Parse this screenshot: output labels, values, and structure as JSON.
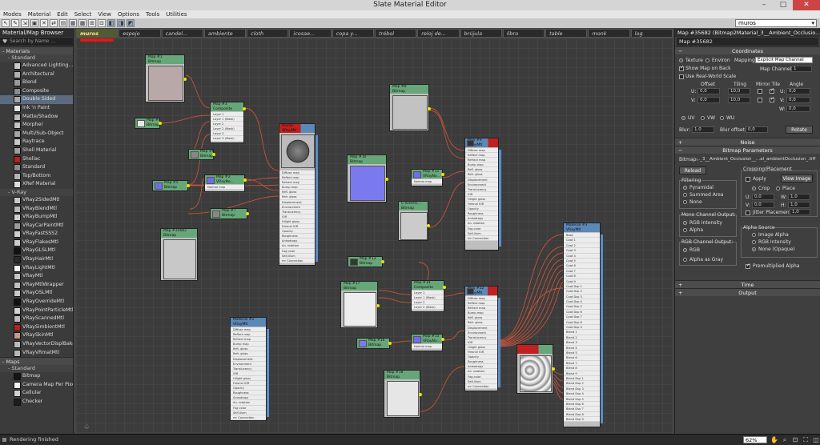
{
  "app": {
    "title": "Slate Material Editor",
    "window_controls": [
      "–",
      "□",
      "✕"
    ],
    "menu": [
      "Modes",
      "Material",
      "Edit",
      "Select",
      "View",
      "Options",
      "Tools",
      "Utilities"
    ],
    "material_dropdown": "muros",
    "status": "Rendering finished",
    "zoom": "62%"
  },
  "browser": {
    "title": "Material/Map Browser",
    "search_placeholder": "Search by Name ...",
    "materials_label": "- Materials",
    "standard_label": "- Standard",
    "standard_items": [
      "Advanced Lighting...",
      "Architectural",
      "Blend",
      "Composite",
      "Double Sided",
      "Ink 'n Paint",
      "Matte/Shadow",
      "Morpher",
      "Multi/Sub-Object",
      "Raytrace",
      "Shell Material",
      "Shellac",
      "Standard",
      "Top/Bottom",
      "XRef Material"
    ],
    "standard_swatches": [
      "#c9c9c9",
      "#b0b0b0",
      "#9a9a9a",
      "#8c8c8c",
      "#a8a8a8",
      "#e5e5e5",
      "#bcbcbc",
      "#c4c4c4",
      "#a5a5a5",
      "#c8c8c8",
      "#9e9e9e",
      "#b52222",
      "#8a8a8a",
      "#b4b4b4",
      "#dddddd"
    ],
    "vray_label": "- V-Ray",
    "vray_items": [
      "VRay2SidedMtl",
      "VRayBlendMtl",
      "VRayBumpMtl",
      "VRayCarPaintMtl",
      "VRayFastSSS2",
      "VRayFlakesMtl",
      "VRayGLSLMtl",
      "VRayHairMtl",
      "VRayLightMtl",
      "VRayMtl",
      "VRayMtlWrapper",
      "VRayOSLMtl",
      "VRayOverrideMtl",
      "VRayPointParticleMtl",
      "VRayScannedMtl",
      "VRaySimbiontMtl",
      "VRaySkinMtl",
      "VRayVectorDisplBake",
      "VRayVRmatMtl"
    ],
    "vray_swatches": [
      "#c9c9c9",
      "#b8b8b8",
      "#cfcfcf",
      "#9a9a9a",
      "#d0d0d0",
      "#cccccc",
      "#111111",
      "#2a2a2a",
      "#f5f5f5",
      "#c6c6c6",
      "#c0c0c0",
      "#c8c8c8",
      "#111111",
      "#d5d5d5",
      "#bdbdbd",
      "#b52222",
      "#c59a8a",
      "#bababa",
      "#b8b8b8"
    ],
    "maps_label": "- Maps",
    "maps_standard_label": "- Standard",
    "maps_items": [
      "Bitmap",
      "Camera Map Per Pixel",
      "Cellular",
      "Checker"
    ],
    "maps_swatches": [
      "#151515",
      "#f4f4f4",
      "#cfcfcf",
      "#1d1d1d"
    ]
  },
  "view_tabs": [
    "muros",
    "espejo",
    "candel...",
    "ambiente",
    "cloth",
    "icosae...",
    "copa y...",
    "trébol",
    "reloj de...",
    "brújula",
    "libro",
    "table",
    "monk",
    "log"
  ],
  "nodes": {
    "map1": "Map #1\nBitmap",
    "map2": "Map #2\nVRayNo...",
    "map3": "Map #3\nComposite",
    "map4": "Map #4\nBitmap",
    "map5": "Map #5\nBitmap",
    "map6": "Map #6\nBitmap",
    "map7": "Map #7\nBitmap",
    "map8": "Map #8\nBitmap",
    "map9": "Map #9\nVRayMtl",
    "map10": "Map #10\nBitmap",
    "map11": "Map #11\nVRayNo...",
    "map12": "Map #12\nVRayMtl",
    "map13": "Map #13\nBitmap",
    "map14": "Map #14\nComposite",
    "map15": "Map #15\nVRayNo...",
    "map16": "Map #16\nBitmap",
    "map17": "Map #17\nBitmap",
    "map18": "Map #18\nBitmap",
    "map35682": "Map #35682\nBitmap",
    "muros": "muros\nVRayMtl",
    "mat2": "Material #2\nVRayMtl",
    "multimat": "Material #3\nVRayMtl",
    "ambocc": "C:\\Users\\...\nBitmap"
  },
  "slots": {
    "composite": [
      "Layer 1",
      "Layer 1 (Mask)",
      "Layer 2",
      "Layer 2 (Mask)",
      "Layer 3",
      "Layer 3 (Mask)"
    ],
    "composite_short": [
      "Layer 1",
      "Layer 1 (Mask)",
      "Layer 2",
      "Layer 2 (Mask)"
    ],
    "vraynormal": [
      "Normal map"
    ],
    "vraymtl": [
      "Diffuse map",
      "Reflect map",
      "Refract map",
      "Bump map",
      "Refl. gloss",
      "Refr. gloss",
      "Displacement",
      "Environment",
      "Translucency",
      "IOR",
      "Hilight gloss",
      "Fresnel IOR",
      "Opacity",
      "Roughness",
      "Anisotropy",
      "An. rotation",
      "Fog color",
      "Self-illum",
      "mr Connection"
    ],
    "multimat": [
      "Base",
      "Coat 1",
      "Coat 2",
      "Coat 3",
      "Coat 4",
      "Coat 5",
      "Coat 6",
      "Coat 7",
      "Coat 8",
      "Coat 9",
      "Coat Dsp 1",
      "Coat Dsp 2",
      "Coat Dsp 3",
      "Coat Dsp 4",
      "Coat Dsp 5",
      "Coat Dsp 6",
      "Coat Dsp 7",
      "Coat Dsp 8",
      "Coat Dsp 9",
      "Blend 1",
      "Blend 2",
      "Blend 3",
      "Blend 4",
      "Blend 5",
      "Blend 6",
      "Blend 7",
      "Blend 8",
      "Blend 9",
      "Blend Dsp 1",
      "Blend Dsp 2",
      "Blend Dsp 3",
      "Blend Dsp 4",
      "Blend Dsp 5",
      "Blend Dsp 6",
      "Blend Dsp 7",
      "Blend Dsp 8",
      "Blend Dsp 9"
    ]
  },
  "props": {
    "title": "Map #35682 (Bitmap2Material_3__Ambient_Occlusio...",
    "name": "Map #35682",
    "coords": {
      "label": "Coordinates",
      "texture": "Texture",
      "environ": "Environ",
      "mapping_label": "Mapping:",
      "mapping": "Explicit Map Channel",
      "show_map": "Show Map on Back",
      "map_channel_label": "Map Channel:",
      "map_channel": "1",
      "realworld": "Use Real-World Scale",
      "offset": "Offset",
      "tiling": "Tiling",
      "mirror_tile": "Mirror Tile",
      "angle": "Angle",
      "u": "U:",
      "v": "V:",
      "w": "W:",
      "u_offset": "0,0",
      "v_offset": "0,0",
      "u_tiling": "10,0",
      "v_tiling": "10,0",
      "u_angle": "0,0",
      "v_angle": "0,0",
      "w_angle": "0,0",
      "uv": "UV",
      "vw": "VW",
      "wu": "WU",
      "blur_label": "Blur:",
      "blur": "1,0",
      "blur_offset_label": "Blur offset:",
      "blur_offset": "0,0",
      "rotate": "Rotate"
    },
    "noise": "Noise",
    "bitmap_params": "Bitmap Parameters",
    "bitmap_label": "Bitmap:",
    "bitmap_path": "..._3__Ambient_Occlusion__...al_ambientOcclusion_.tiff",
    "reload": "Reload",
    "cropping": "Cropping/Placement",
    "apply": "Apply",
    "view_image": "View Image",
    "crop": "Crop",
    "place": "Place",
    "u_label": "U:",
    "w_label": "W:",
    "v_label": "V:",
    "h_label": "H:",
    "crop_u": "0,0",
    "crop_w": "1,0",
    "crop_v": "0,0",
    "crop_h": "1,0",
    "jitter": "Jitter Placement:",
    "jitter_val": "1,0",
    "filtering": "Filtering",
    "pyramidal": "Pyramidal",
    "summed": "Summed Area",
    "none": "None",
    "mono": "Mono Channel Output:",
    "rgb_int": "RGB Intensity",
    "alpha": "Alpha",
    "rgb_out": "RGB Channel Output:",
    "rgb": "RGB",
    "alpha_gray": "Alpha as Gray",
    "alpha_source": "Alpha Source",
    "image_alpha": "Image Alpha",
    "rgb_intensity": "RGB Intensity",
    "none_opaque": "None (Opaque)",
    "premult": "Premultiplied Alpha",
    "time": "Time",
    "output": "Output"
  }
}
